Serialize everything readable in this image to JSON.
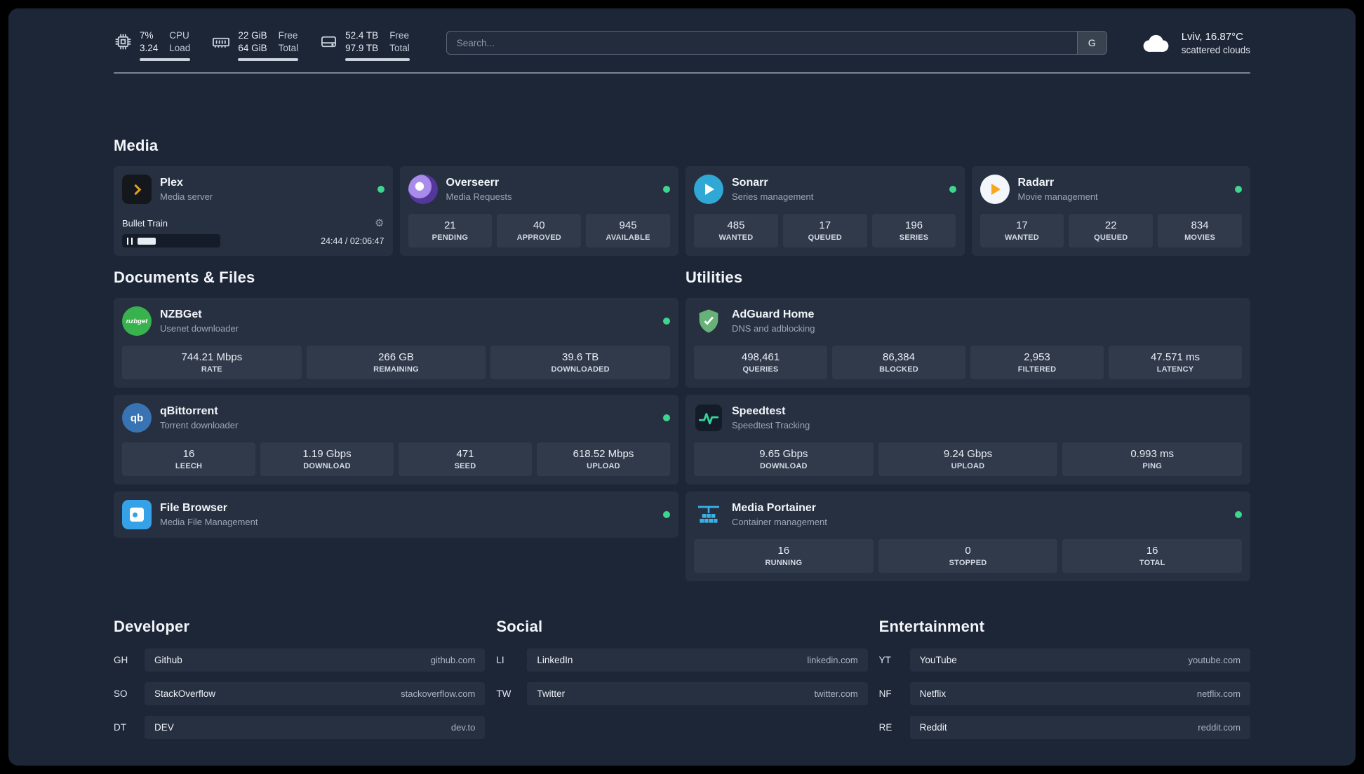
{
  "colors": {
    "status_online": "#3dd68c",
    "accent_plex": "#e5a00d",
    "accent_radarr": "#fba51d",
    "accent_sonarr": "#2fa8d5",
    "accent_adguard": "#67b279",
    "accent_portainer": "#3bb0e5"
  },
  "topbar": {
    "cpu": {
      "values": [
        "7%",
        "3.24"
      ],
      "labels": [
        "CPU",
        "Load"
      ]
    },
    "memory": {
      "values": [
        "22 GiB",
        "64 GiB"
      ],
      "labels": [
        "Free",
        "Total"
      ]
    },
    "disk": {
      "values": [
        "52.4 TB",
        "97.9 TB"
      ],
      "labels": [
        "Free",
        "Total"
      ]
    },
    "search": {
      "placeholder": "Search...",
      "provider_letter": "G"
    },
    "weather": {
      "location": "Lviv, 16.87°C",
      "condition": "scattered clouds"
    }
  },
  "media": {
    "heading": "Media",
    "cards": [
      {
        "name": "Plex",
        "subtitle": "Media server",
        "online": true,
        "player": {
          "track": "Bullet Train",
          "gear_icon": "⚙",
          "time": "24:44 / 02:06:47"
        }
      },
      {
        "name": "Overseerr",
        "subtitle": "Media Requests",
        "online": true,
        "stats": [
          {
            "value": "21",
            "label": "PENDING"
          },
          {
            "value": "40",
            "label": "APPROVED"
          },
          {
            "value": "945",
            "label": "AVAILABLE"
          }
        ]
      },
      {
        "name": "Sonarr",
        "subtitle": "Series management",
        "online": true,
        "stats": [
          {
            "value": "485",
            "label": "WANTED"
          },
          {
            "value": "17",
            "label": "QUEUED"
          },
          {
            "value": "196",
            "label": "SERIES"
          }
        ]
      },
      {
        "name": "Radarr",
        "subtitle": "Movie management",
        "online": true,
        "stats": [
          {
            "value": "17",
            "label": "WANTED"
          },
          {
            "value": "22",
            "label": "QUEUED"
          },
          {
            "value": "834",
            "label": "MOVIES"
          }
        ]
      }
    ]
  },
  "documents": {
    "heading": "Documents & Files",
    "cards": [
      {
        "name": "NZBGet",
        "subtitle": "Usenet downloader",
        "online": true,
        "icon_text": "nzbget",
        "stats": [
          {
            "value": "744.21 Mbps",
            "label": "RATE"
          },
          {
            "value": "266 GB",
            "label": "REMAINING"
          },
          {
            "value": "39.6 TB",
            "label": "DOWNLOADED"
          }
        ]
      },
      {
        "name": "qBittorrent",
        "subtitle": "Torrent downloader",
        "online": true,
        "icon_text": "qb",
        "stats": [
          {
            "value": "16",
            "label": "LEECH"
          },
          {
            "value": "1.19 Gbps",
            "label": "DOWNLOAD"
          },
          {
            "value": "471",
            "label": "SEED"
          },
          {
            "value": "618.52 Mbps",
            "label": "UPLOAD"
          }
        ]
      },
      {
        "name": "File Browser",
        "subtitle": "Media File Management",
        "online": true,
        "stats": []
      }
    ]
  },
  "utilities": {
    "heading": "Utilities",
    "cards": [
      {
        "name": "AdGuard Home",
        "subtitle": "DNS and adblocking",
        "online": false,
        "stats": [
          {
            "value": "498,461",
            "label": "QUERIES"
          },
          {
            "value": "86,384",
            "label": "BLOCKED"
          },
          {
            "value": "2,953",
            "label": "FILTERED"
          },
          {
            "value": "47.571 ms",
            "label": "LATENCY"
          }
        ]
      },
      {
        "name": "Speedtest",
        "subtitle": "Speedtest Tracking",
        "online": false,
        "stats": [
          {
            "value": "9.65 Gbps",
            "label": "DOWNLOAD"
          },
          {
            "value": "9.24 Gbps",
            "label": "UPLOAD"
          },
          {
            "value": "0.993 ms",
            "label": "PING"
          }
        ]
      },
      {
        "name": "Media Portainer",
        "subtitle": "Container management",
        "online": true,
        "stats": [
          {
            "value": "16",
            "label": "RUNNING"
          },
          {
            "value": "0",
            "label": "STOPPED"
          },
          {
            "value": "16",
            "label": "TOTAL"
          }
        ]
      }
    ]
  },
  "bookmarks": {
    "groups": [
      {
        "heading": "Developer",
        "items": [
          {
            "abbr": "GH",
            "name": "Github",
            "url": "github.com"
          },
          {
            "abbr": "SO",
            "name": "StackOverflow",
            "url": "stackoverflow.com"
          },
          {
            "abbr": "DT",
            "name": "DEV",
            "url": "dev.to"
          }
        ]
      },
      {
        "heading": "Social",
        "items": [
          {
            "abbr": "LI",
            "name": "LinkedIn",
            "url": "linkedin.com"
          },
          {
            "abbr": "TW",
            "name": "Twitter",
            "url": "twitter.com"
          }
        ]
      },
      {
        "heading": "Entertainment",
        "items": [
          {
            "abbr": "YT",
            "name": "YouTube",
            "url": "youtube.com"
          },
          {
            "abbr": "NF",
            "name": "Netflix",
            "url": "netflix.com"
          },
          {
            "abbr": "RE",
            "name": "Reddit",
            "url": "reddit.com"
          }
        ]
      }
    ]
  }
}
